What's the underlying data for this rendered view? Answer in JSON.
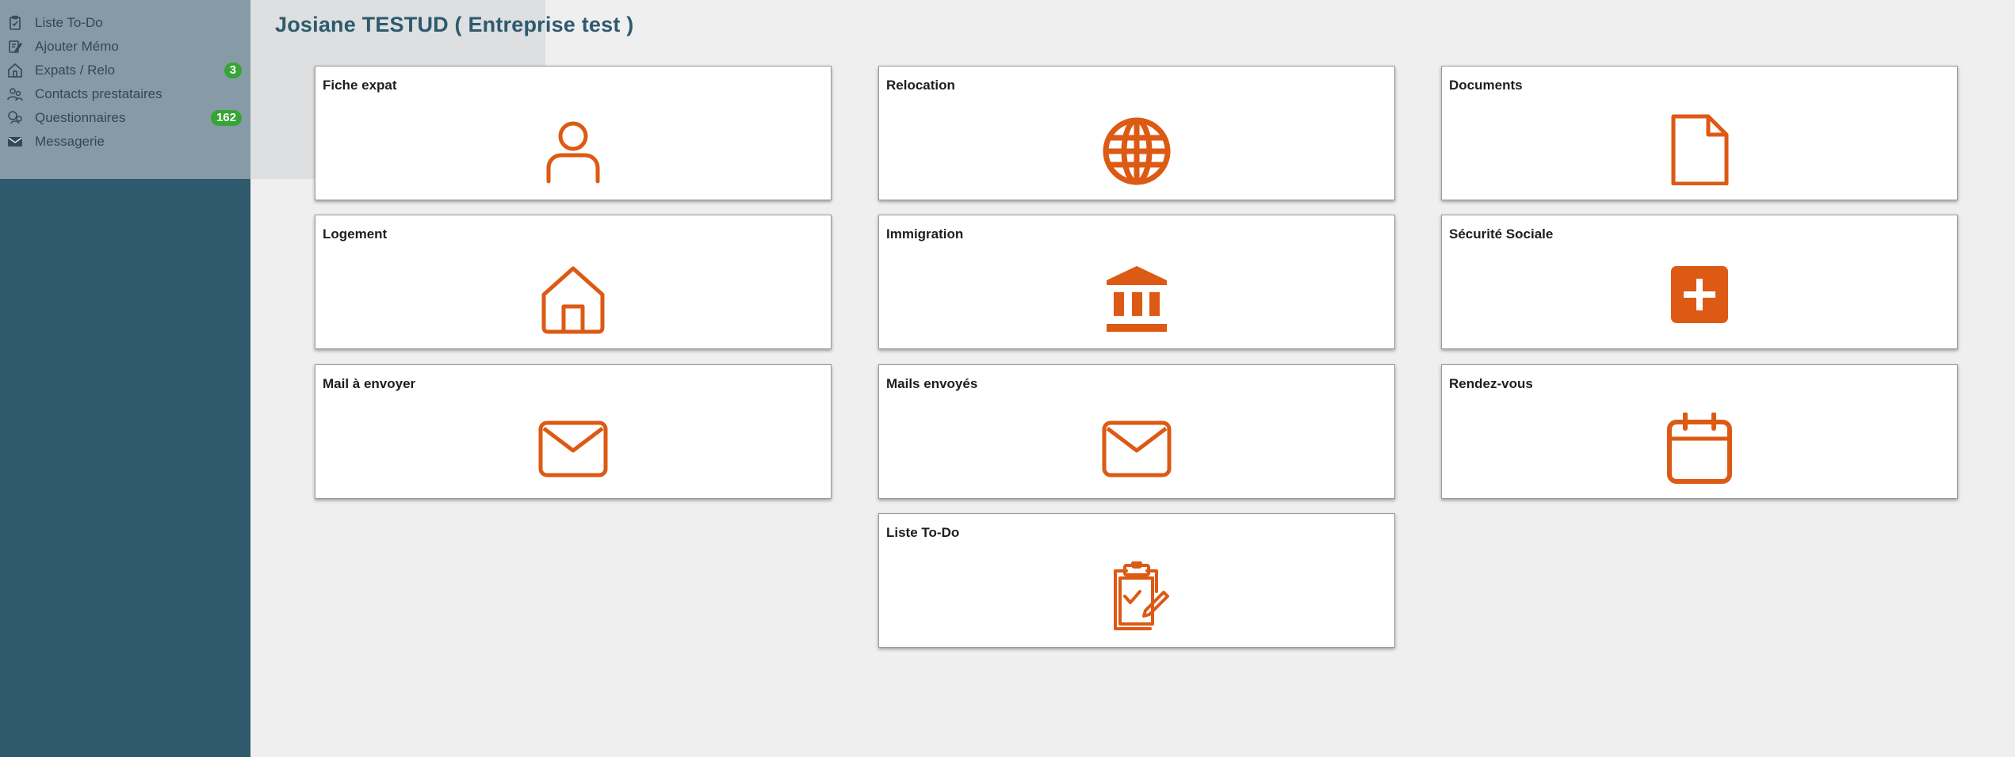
{
  "page": {
    "title": "Josiane TESTUD ( Entreprise test )"
  },
  "sidebar": {
    "items": [
      {
        "label": "Liste To-Do",
        "icon": "clipboard-check-icon"
      },
      {
        "label": "Ajouter Mémo",
        "icon": "memo-edit-icon"
      },
      {
        "label": "Expats / Relo",
        "icon": "house-icon",
        "badge": "3"
      },
      {
        "label": "Contacts prestataires",
        "icon": "contacts-icon"
      },
      {
        "label": "Questionnaires",
        "icon": "questionnaire-icon",
        "badge": "162"
      },
      {
        "label": "Messagerie",
        "icon": "envelope-icon"
      }
    ]
  },
  "cards": [
    {
      "title": "Fiche expat",
      "icon": "person-icon"
    },
    {
      "title": "Relocation",
      "icon": "globe-icon"
    },
    {
      "title": "Documents",
      "icon": "document-icon"
    },
    {
      "title": "Logement",
      "icon": "house-icon"
    },
    {
      "title": "Immigration",
      "icon": "institution-icon"
    },
    {
      "title": "Sécurité Sociale",
      "icon": "medical-plus-icon"
    },
    {
      "title": "Mail à envoyer",
      "icon": "envelope-icon"
    },
    {
      "title": "Mails envoyés",
      "icon": "envelope-icon"
    },
    {
      "title": "Rendez-vous",
      "icon": "calendar-icon"
    },
    {
      "title": "Liste To-Do",
      "icon": "clipboard-check-icon"
    }
  ],
  "colors": {
    "sidebar_bg": "#2f5a6e",
    "accent_orange": "#dc5a14",
    "badge_green": "#35a535",
    "title_blue": "#2d5a6e"
  }
}
